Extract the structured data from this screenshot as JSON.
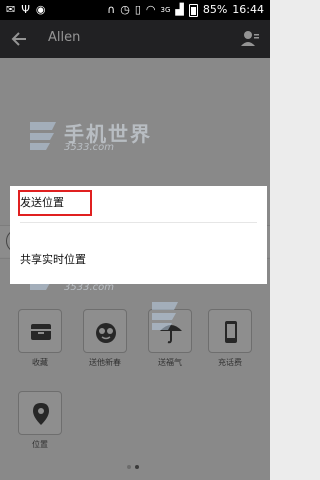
{
  "status_bar": {
    "network": "3G",
    "battery": "85%",
    "time": "16:44"
  },
  "header": {
    "title": "Allen"
  },
  "watermark": {
    "text": "手机世界",
    "sub": "3533.com"
  },
  "dialog": {
    "items": [
      {
        "label": "发送位置"
      },
      {
        "label": "共享实时位置"
      }
    ]
  },
  "panel": {
    "tiles": [
      {
        "label": "收藏",
        "icon": "favorites-icon"
      },
      {
        "label": "送他新春",
        "icon": "sticker-icon"
      },
      {
        "label": "送福气",
        "icon": "red-packet-icon"
      },
      {
        "label": "充话费",
        "icon": "phone-icon"
      },
      {
        "label": "位置",
        "icon": "location-icon"
      }
    ],
    "page_indicator": {
      "count": 2,
      "active": 1
    }
  }
}
